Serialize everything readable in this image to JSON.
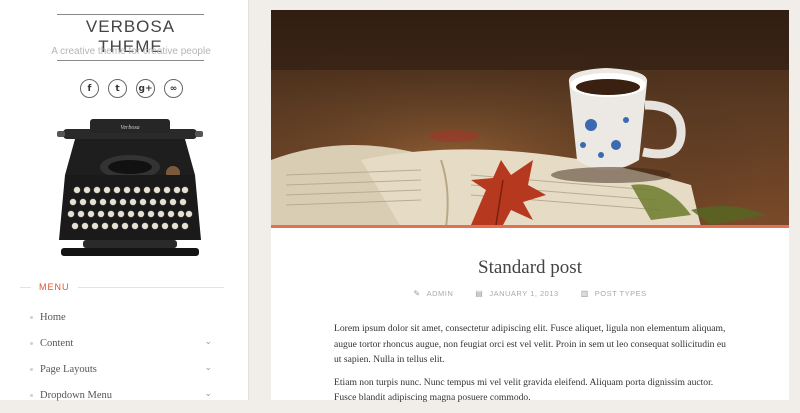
{
  "site": {
    "title": "VERBOSA THEME",
    "tagline": "A creative theme for creative people"
  },
  "socials": [
    {
      "icon": "facebook-icon",
      "glyph": "f"
    },
    {
      "icon": "twitter-icon",
      "glyph": "t"
    },
    {
      "icon": "google-plus-icon",
      "glyph": "g+"
    },
    {
      "icon": "link-icon",
      "glyph": "∞"
    }
  ],
  "typewriter_brand": "Verbosa",
  "menu": {
    "heading": "MENU",
    "items": [
      {
        "label": "Home",
        "has_children": false
      },
      {
        "label": "Content",
        "has_children": true
      },
      {
        "label": "Page Layouts",
        "has_children": true
      },
      {
        "label": "Dropdown Menu",
        "has_children": true
      }
    ]
  },
  "post": {
    "title": "Standard post",
    "author": "ADMIN",
    "date": "JANUARY 1, 2013",
    "category": "POST TYPES",
    "paragraphs": [
      "Lorem ipsum dolor sit amet, consectetur adipiscing elit. Fusce aliquet, ligula non elementum aliquam, augue tortor rhoncus augue, non feugiat orci est vel velit. Proin in sem ut leo consequat sollicitudin eu ut sapien. Nulla in tellus elit.",
      "Etiam non turpis nunc. Nunc tempus mi vel velit gravida eleifend. Aliquam porta dignissim auctor. Fusce blandit adipiscing magna posuere commodo."
    ]
  },
  "colors": {
    "accent": "#d9562c",
    "hero_border": "#e07251",
    "page_bg": "#f1ede8"
  }
}
